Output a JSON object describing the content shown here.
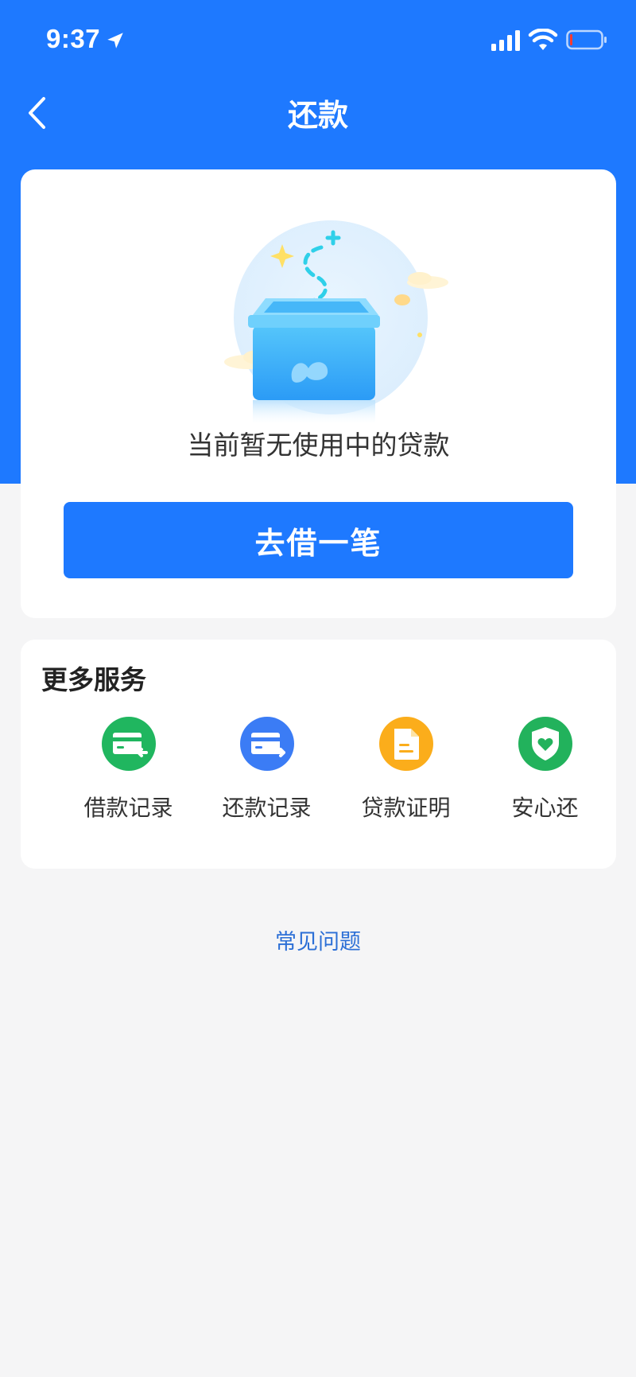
{
  "status_bar": {
    "time": "9:37"
  },
  "nav": {
    "title": "还款"
  },
  "empty_state": {
    "message": "当前暂无使用中的贷款"
  },
  "borrow_button": {
    "label": "去借一笔"
  },
  "services": {
    "title": "更多服务",
    "items": [
      {
        "label": "借款记录",
        "icon": "borrow-record-icon",
        "color": "#20b65f"
      },
      {
        "label": "还款记录",
        "icon": "repay-record-icon",
        "color": "#3b7cf5"
      },
      {
        "label": "贷款证明",
        "icon": "loan-certificate-icon",
        "color": "#fbad1b"
      },
      {
        "label": "安心还",
        "icon": "shield-heart-icon",
        "color": "#22b25c"
      }
    ]
  },
  "faq": {
    "label": "常见问题"
  },
  "colors": {
    "brand": "#1e79ff",
    "link": "#2c6fd6",
    "background": "#f5f5f6"
  }
}
